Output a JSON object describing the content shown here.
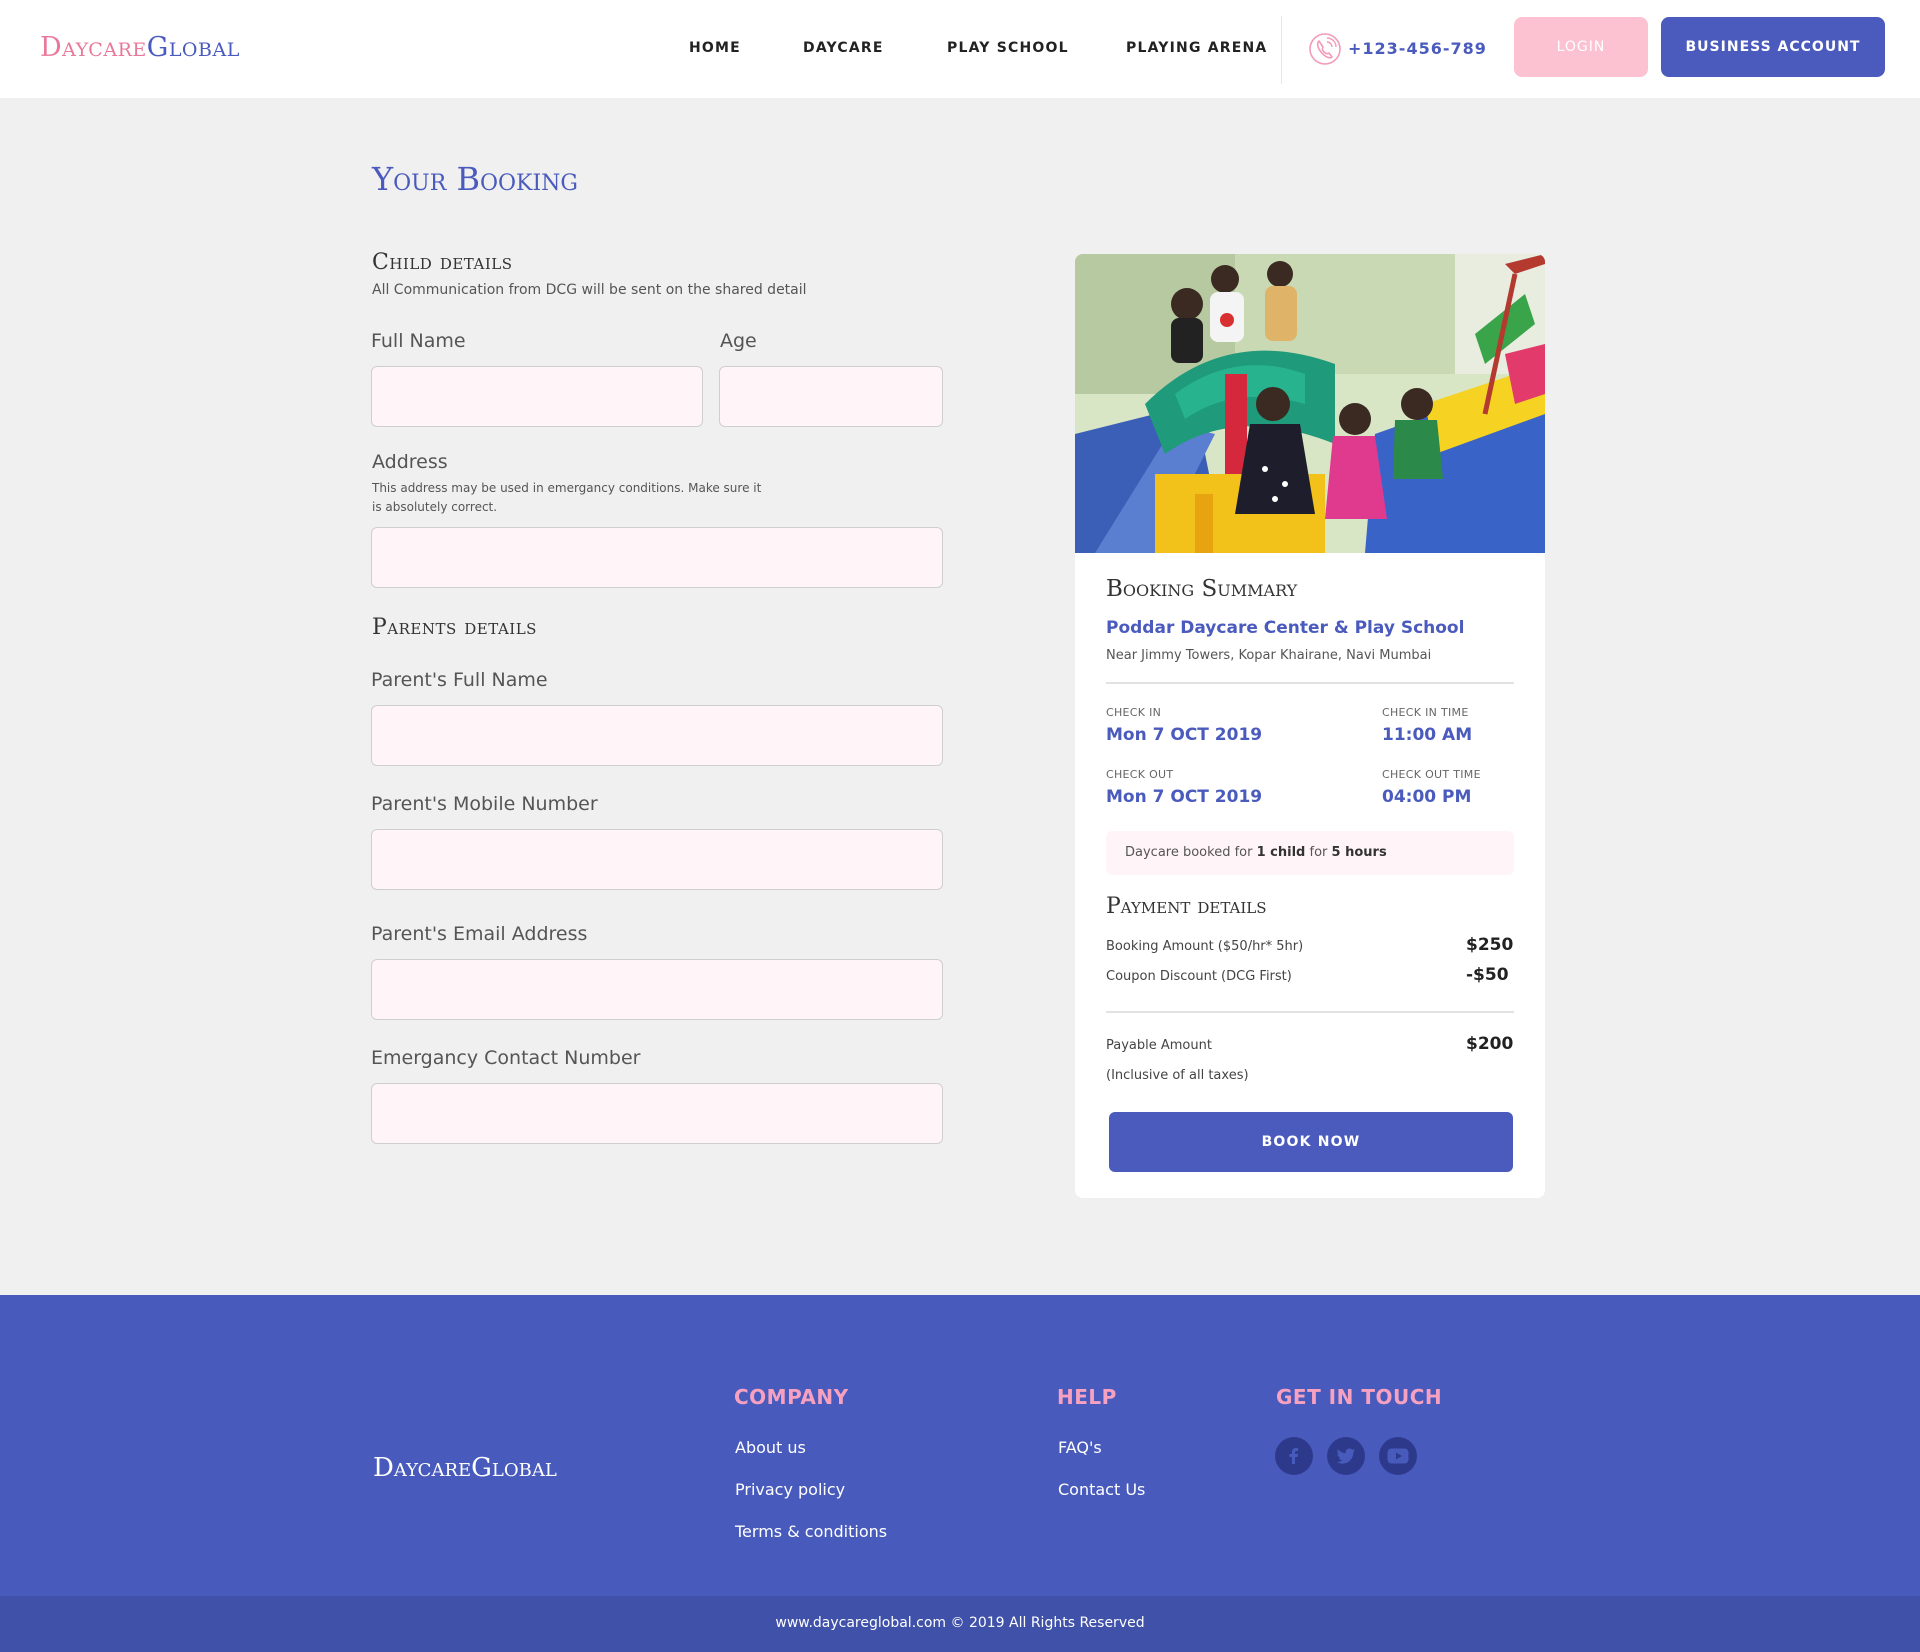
{
  "header": {
    "logo_part1": "Daycare",
    "logo_part2": "Global",
    "nav": [
      "HOME",
      "DAYCARE",
      "PLAY SCHOOL",
      "PLAYING ARENA"
    ],
    "phone": "+123-456-789",
    "login": "LOGIN",
    "business": "BUSINESS ACCOUNT"
  },
  "page": {
    "title": "Your Booking"
  },
  "child": {
    "title": "Child details",
    "note": "All Communication from DCG will be sent on the shared detail",
    "full_name_label": "Full Name",
    "full_name_value": "",
    "age_label": "Age",
    "age_value": "",
    "address_label": "Address",
    "address_note": "This address may be used in emergancy conditions. Make sure it is absolutely correct.",
    "address_value": ""
  },
  "parents": {
    "title": "Parents details",
    "full_name_label": "Parent's Full Name",
    "mobile_label": "Parent's Mobile Number",
    "email_label": "Parent's Email Address",
    "emergency_label": "Emergancy Contact Number",
    "full_name_value": "",
    "mobile_value": "",
    "email_value": "",
    "emergency_value": ""
  },
  "summary": {
    "title": "Booking Summary",
    "center_name": "Poddar Daycare Center & Play School",
    "center_address": "Near Jimmy Towers, Kopar Khairane, Navi Mumbai",
    "check_in_label": "CHECK IN",
    "check_in_date": "Mon 7 OCT 2019",
    "check_in_time_label": "CHECK IN TIME",
    "check_in_time": "11:00 AM",
    "check_out_label": "CHECK OUT",
    "check_out_date": "Mon 7 OCT 2019",
    "check_out_time_label": "CHECK OUT TIME",
    "check_out_time": "04:00 PM",
    "booked_prefix": "Daycare booked for",
    "booked_children": "1 child",
    "booked_mid": "for",
    "booked_hours": "5 hours"
  },
  "payment": {
    "title": "Payment details",
    "booking_label": "Booking Amount ($50/hr* 5hr)",
    "booking_amount": "$250",
    "coupon_label": "Coupon Discount (DCG First)",
    "coupon_amount": "-$50",
    "payable_label": "Payable Amount",
    "payable_note": "(Inclusive of all taxes)",
    "payable_amount": "$200",
    "book_button": "BOOK NOW"
  },
  "footer": {
    "logo": "DaycareGlobal",
    "company_title": "COMPANY",
    "company_links": [
      "About us",
      "Privacy policy",
      "Terms & conditions"
    ],
    "help_title": "HELP",
    "help_links": [
      "FAQ's",
      "Contact Us"
    ],
    "touch_title": "GET IN TOUCH",
    "social": [
      "facebook-icon",
      "twitter-icon",
      "youtube-icon"
    ],
    "copyright": "www.daycareglobal.com © 2019 All Rights Reserved"
  },
  "colors": {
    "brand_blue": "#4a5bbd",
    "brand_pink": "#e8799b",
    "login_pink": "#fdc2d2",
    "footer_blue": "#485bbd",
    "footer_heading": "#f7a1c1"
  }
}
